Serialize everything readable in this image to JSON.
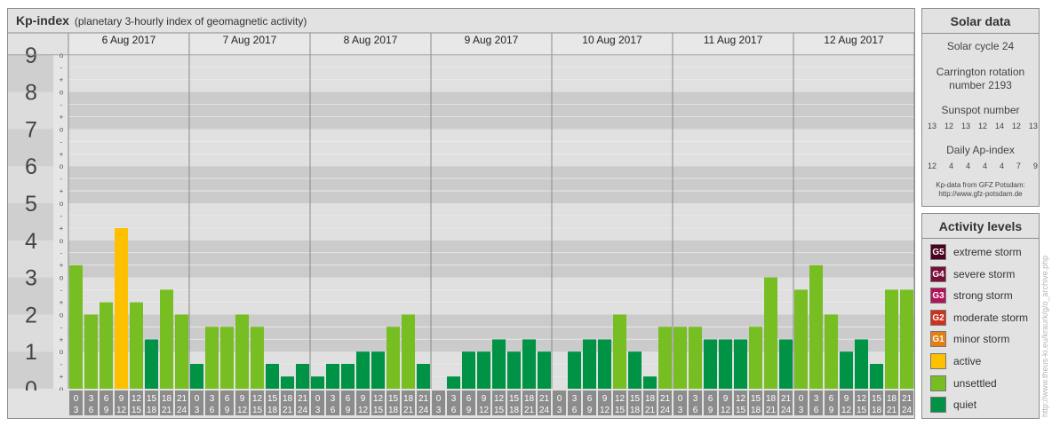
{
  "header": {
    "title": "Kp-index",
    "subtitle": "(planetary 3-hourly index of geomagnetic activity)"
  },
  "chart_data": {
    "type": "bar",
    "title": "Kp-index",
    "subtitle": "(planetary 3-hourly index of geomagnetic activity)",
    "ylim": [
      0,
      9
    ],
    "yticks": [
      "0",
      "1",
      "2",
      "3",
      "4",
      "5",
      "6",
      "7",
      "8",
      "9"
    ],
    "minor_tick_labels": [
      "+",
      "o",
      "-"
    ],
    "days": [
      "6 Aug 2017",
      "7 Aug 2017",
      "8 Aug 2017",
      "9 Aug 2017",
      "10 Aug 2017",
      "11 Aug 2017",
      "12 Aug 2017"
    ],
    "interval_start": [
      "0",
      "3",
      "6",
      "9",
      "12",
      "15",
      "18",
      "21"
    ],
    "interval_end": [
      "3",
      "6",
      "9",
      "12",
      "15",
      "18",
      "21",
      "24"
    ],
    "values": [
      [
        3.33,
        2.0,
        2.33,
        4.33,
        2.33,
        1.33,
        2.67,
        2.0
      ],
      [
        0.67,
        1.67,
        1.67,
        2.0,
        1.67,
        0.67,
        0.33,
        0.67
      ],
      [
        0.33,
        0.67,
        0.67,
        1.0,
        1.0,
        1.67,
        2.0,
        0.67
      ],
      [
        0.0,
        0.33,
        1.0,
        1.0,
        1.33,
        1.0,
        1.33,
        1.0
      ],
      [
        0.0,
        1.0,
        1.33,
        1.33,
        2.0,
        1.0,
        0.33,
        1.67
      ],
      [
        1.67,
        1.67,
        1.33,
        1.33,
        1.33,
        1.67,
        3.0,
        1.33
      ],
      [
        2.67,
        3.33,
        2.0,
        1.0,
        1.33,
        0.67,
        2.67,
        2.67
      ]
    ],
    "grid": true,
    "colors": {
      "quiet": "#009245",
      "unsettled": "#77be22",
      "active": "#ffc000"
    }
  },
  "solar": {
    "title": "Solar data",
    "cycle": "Solar cycle 24",
    "carrington_line1": "Carrington rotation",
    "carrington_line2": "number 2193",
    "sunspot_label": "Sunspot number",
    "sunspot_values": [
      "13",
      "12",
      "13",
      "12",
      "14",
      "12",
      "13"
    ],
    "ap_label": "Daily Ap-index",
    "ap_values": [
      "12",
      "4",
      "4",
      "4",
      "4",
      "7",
      "9"
    ],
    "source_line1": "Kp-data from GFZ Potsdam:",
    "source_line2": "http://www.gfz-potsdam.de"
  },
  "activity": {
    "title": "Activity levels",
    "levels": [
      {
        "code": "G5",
        "label": "extreme storm",
        "color": "#4d001f"
      },
      {
        "code": "G4",
        "label": "severe storm",
        "color": "#7a0d3a"
      },
      {
        "code": "G3",
        "label": "strong storm",
        "color": "#b3125a"
      },
      {
        "code": "G2",
        "label": "moderate storm",
        "color": "#d0311a"
      },
      {
        "code": "G1",
        "label": "minor storm",
        "color": "#e67e12"
      },
      {
        "code": "",
        "label": "active",
        "color": "#ffc000"
      },
      {
        "code": "",
        "label": "unsettled",
        "color": "#77be22"
      },
      {
        "code": "",
        "label": "quiet",
        "color": "#009245"
      }
    ]
  },
  "watermark": "http://www.theus-ki.eu/kraurk/g/o_archive.php"
}
